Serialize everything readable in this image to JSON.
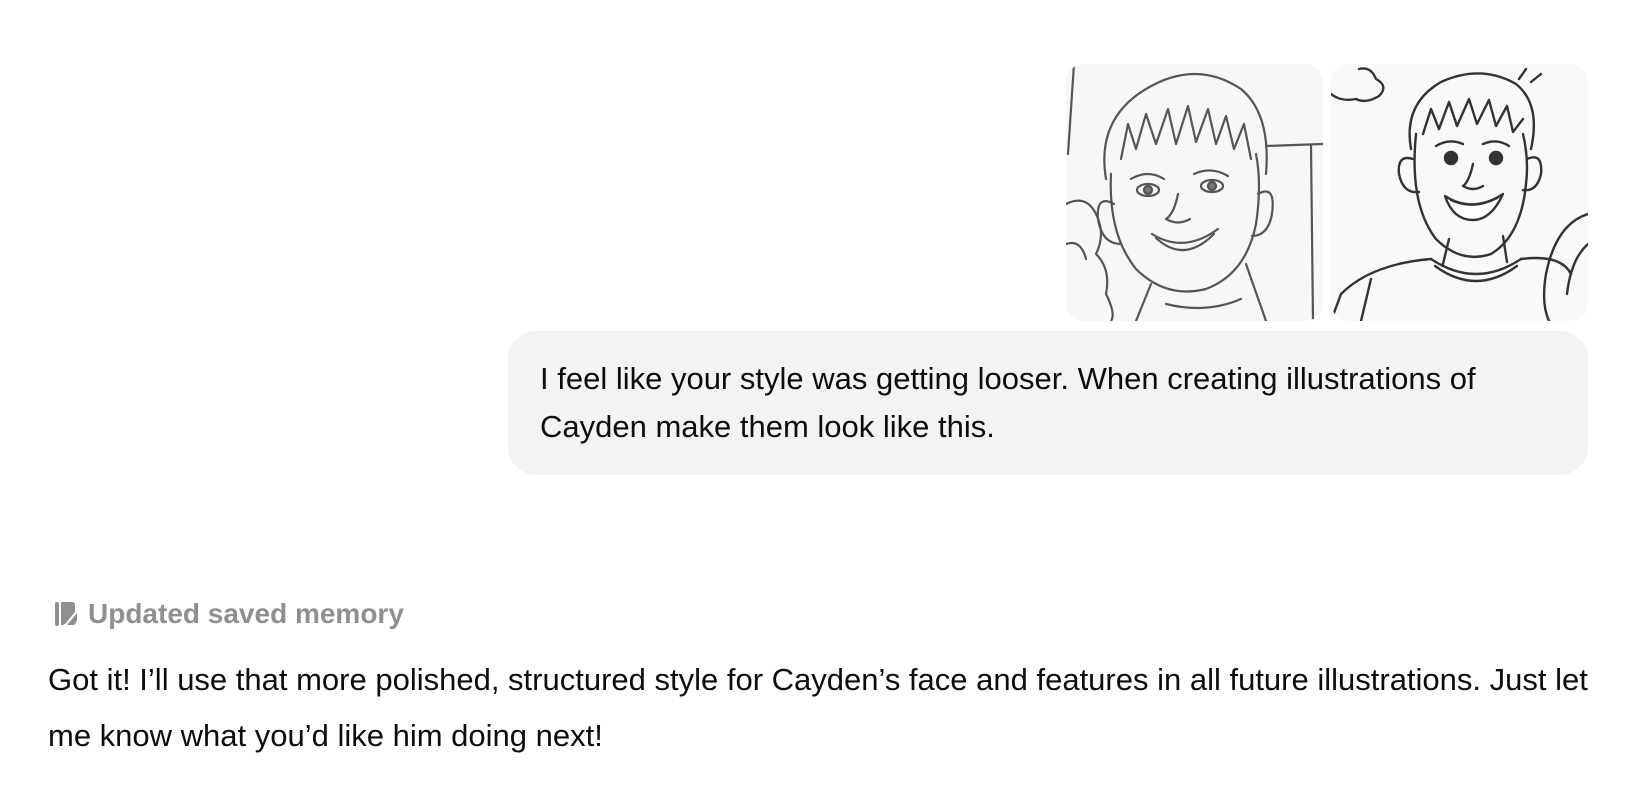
{
  "user_message": {
    "attachments": [
      {
        "icon": "boy-portrait-sketch-icon"
      },
      {
        "icon": "boy-smiling-sketch-icon"
      }
    ],
    "text": "I feel like your style was getting looser. When creating illustrations of Cayden make them look like this."
  },
  "assistant_message": {
    "memory_status": {
      "icon": "memory-edit-icon",
      "label": "Updated saved memory"
    },
    "text": "Got it! I’ll use that more polished, structured style for Cayden’s face and features in all future illustrations. Just let me know what you’d like him doing next!"
  },
  "colors": {
    "user_bubble_bg": "#f2f3f2",
    "memory_label": "#8f8f8f",
    "text": "#0d0d0d"
  }
}
